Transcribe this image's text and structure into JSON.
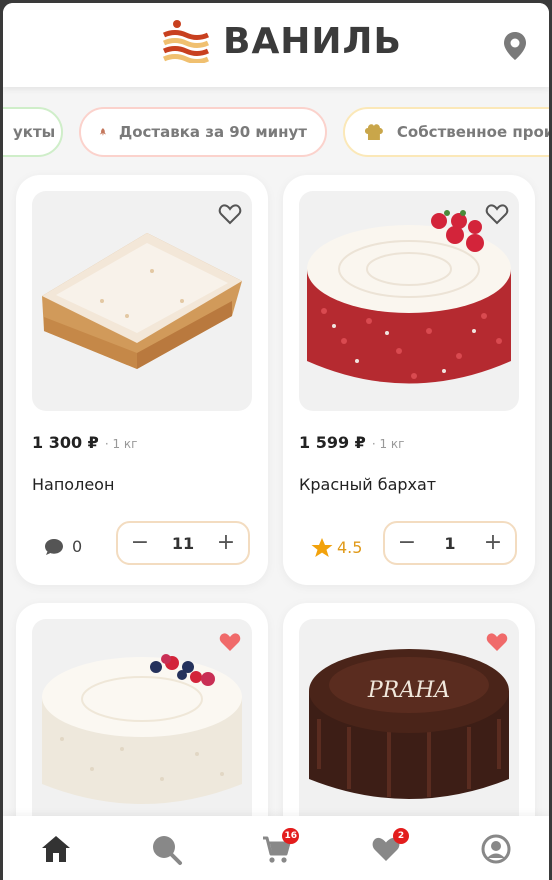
{
  "brand": {
    "name": "ВАНИЛЬ",
    "accent": "#c8401f",
    "stripe": "#f0c070"
  },
  "chips": [
    {
      "label": "укты",
      "icon": "tag-icon",
      "border": "#cfeec9"
    },
    {
      "label": "Доставка за 90 минут",
      "icon": "rocket-icon",
      "border": "#fbd2cc"
    },
    {
      "label": "Собственное произ",
      "icon": "chef-hat-icon",
      "border": "#fbe8b8"
    }
  ],
  "products": [
    {
      "price": "1 300 ₽",
      "weight": "· 1 кг",
      "name": "Наполеон",
      "meta_type": "comments",
      "meta_value": "0",
      "qty": "11",
      "favorite": false
    },
    {
      "price": "1 599 ₽",
      "weight": "· 1 кг",
      "name": "Красный бархат",
      "meta_type": "rating",
      "meta_value": "4.5",
      "qty": "1",
      "favorite": false
    },
    {
      "favorite": true
    },
    {
      "favorite": true,
      "cake_text": "PRAHA"
    }
  ],
  "stepper": {
    "minus": "−",
    "plus": "+"
  },
  "nav": {
    "items": [
      "home-icon",
      "search-icon",
      "cart-icon",
      "favorites-icon",
      "profile-icon"
    ],
    "cart_badge": "16",
    "fav_badge": "2"
  }
}
